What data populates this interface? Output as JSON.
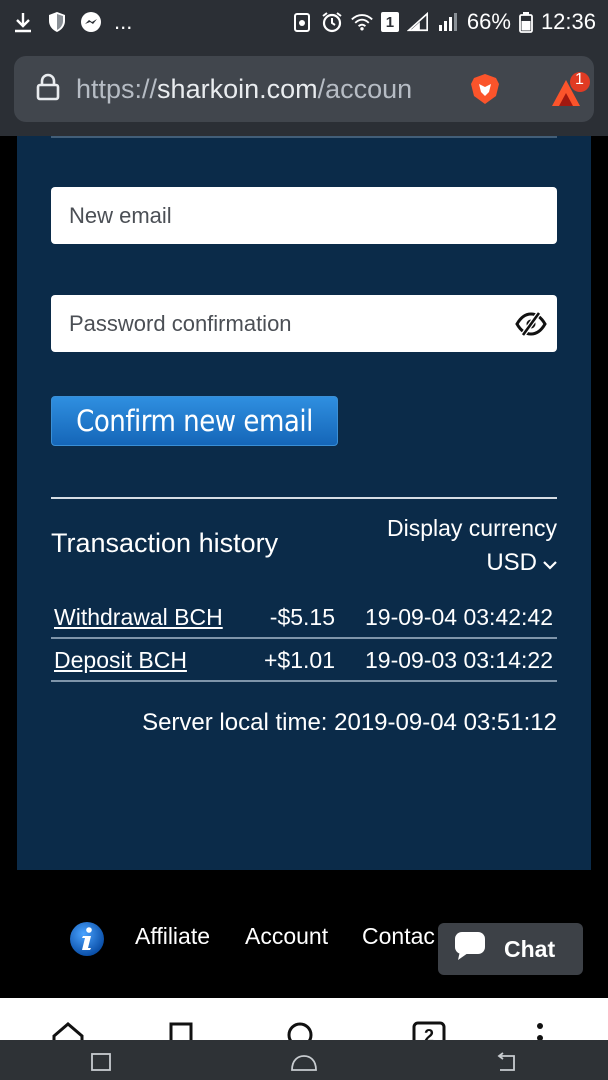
{
  "status_bar": {
    "dots": "...",
    "battery_percent": "66%",
    "time": "12:36",
    "sim_badge": "1"
  },
  "browser": {
    "url_scheme": "https://",
    "url_host": "sharkoin.com",
    "url_path": "/accoun",
    "rewards_badge": "1",
    "tab_count": "2"
  },
  "form": {
    "new_email_placeholder": "New email",
    "password_placeholder": "Password confirmation",
    "confirm_button": "Confirm new email"
  },
  "transactions": {
    "title": "Transaction history",
    "display_currency_label": "Display currency",
    "display_currency_value": "USD",
    "rows": [
      {
        "type": "Withdrawal BCH",
        "amount": "-$5.15",
        "datetime": "19-09-04 03:42:42"
      },
      {
        "type": "Deposit BCH",
        "amount": "+$1.01",
        "datetime": "19-09-03 03:14:22"
      }
    ],
    "server_time": "Server local time: 2019-09-04 03:51:12"
  },
  "footer": {
    "links": [
      "Affiliate",
      "Account",
      "Contac"
    ],
    "chat_label": "Chat"
  },
  "colors": {
    "content_bg": "#0b2b49",
    "button_blue": "#1e78cf",
    "browser_chrome": "#2b2f35"
  }
}
